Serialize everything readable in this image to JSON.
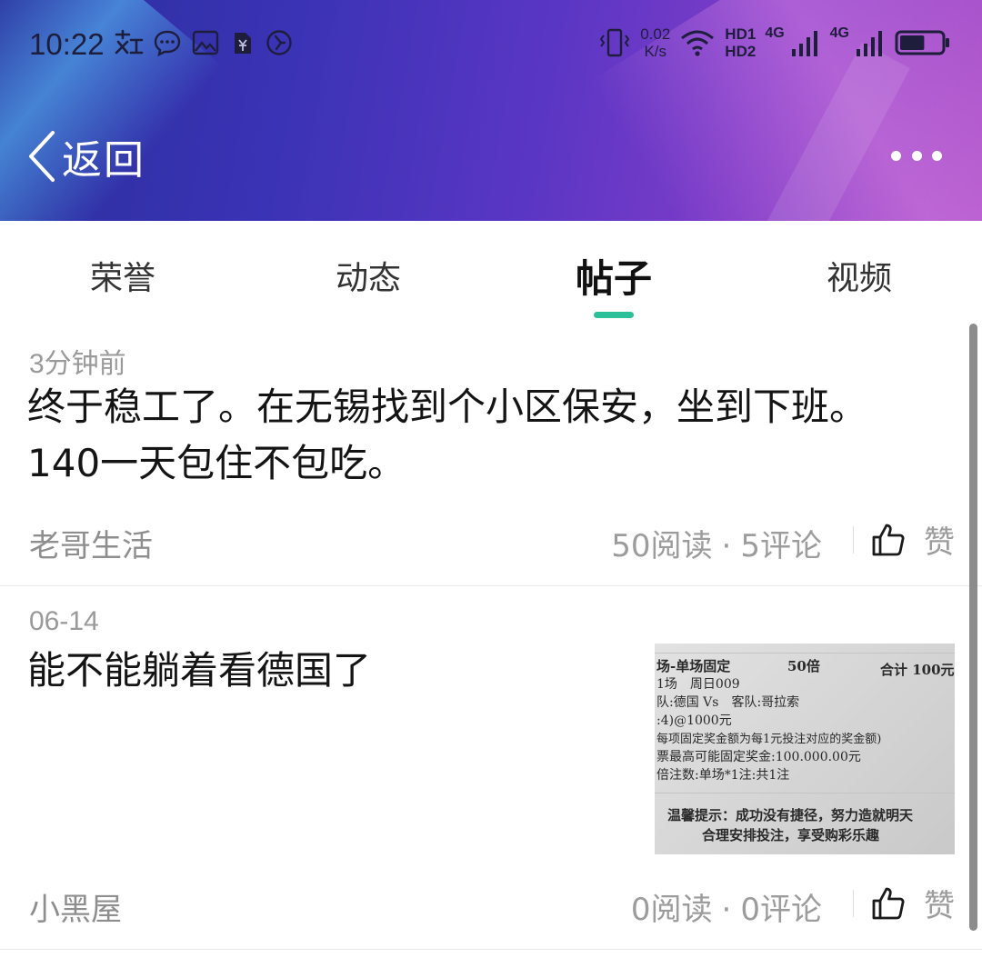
{
  "status_bar": {
    "time": "10:22",
    "net_speed_value": "0.02",
    "net_speed_unit": "K/s",
    "hd1": "HD1",
    "hd2": "HD2",
    "sim1_label": "4G",
    "sim2_label": "4G",
    "battery_level": 0.6,
    "left_icons": [
      "notification-app-icon",
      "message-icon",
      "gallery-icon",
      "sim-app-icon",
      "clock-app-icon"
    ],
    "right_icons": [
      "vibrate-icon",
      "wifi-icon",
      "signal-icon",
      "battery-icon"
    ]
  },
  "header": {
    "back_label": "返回",
    "back_icon": "chevron-left-icon",
    "more_icon": "more-dots-icon",
    "gradient_colors": [
      "#2a2f9c",
      "#5a36c4",
      "#a24ac6"
    ]
  },
  "tabs": [
    {
      "label": "荣誉",
      "active": false
    },
    {
      "label": "动态",
      "active": false
    },
    {
      "label": "帖子",
      "active": true
    },
    {
      "label": "视频",
      "active": false
    }
  ],
  "accent_color": "#2bbf9a",
  "posts": [
    {
      "time": "3分钟前",
      "text": "终于稳工了。在无锡找到个小区保安，坐到下班。140一天包住不包吃。",
      "author": "老哥生活",
      "reads": "50阅读",
      "comments": "5评论",
      "separator": "·",
      "like_label": "赞"
    },
    {
      "time": "06-14",
      "text": "能不能躺着看德国了",
      "author": "小黑屋",
      "reads": "0阅读",
      "comments": "0评论",
      "separator": "·",
      "like_label": "赞",
      "thumbnail": {
        "lines": [
          "场-单场固定",
          "50倍",
          "合计 100元",
          "1场　周日009",
          "队:德国 Vs　客队:哥拉索",
          ":4)@1000元",
          "每项固定奖金额为每1元投注对应的奖金额)",
          "票最高可能固定奖金:100.000.00元",
          "倍注数:单场*1注:共1注",
          "温馨提示：成功没有捷径，努力造就明天",
          "合理安排投注，享受购彩乐趣"
        ]
      }
    }
  ]
}
